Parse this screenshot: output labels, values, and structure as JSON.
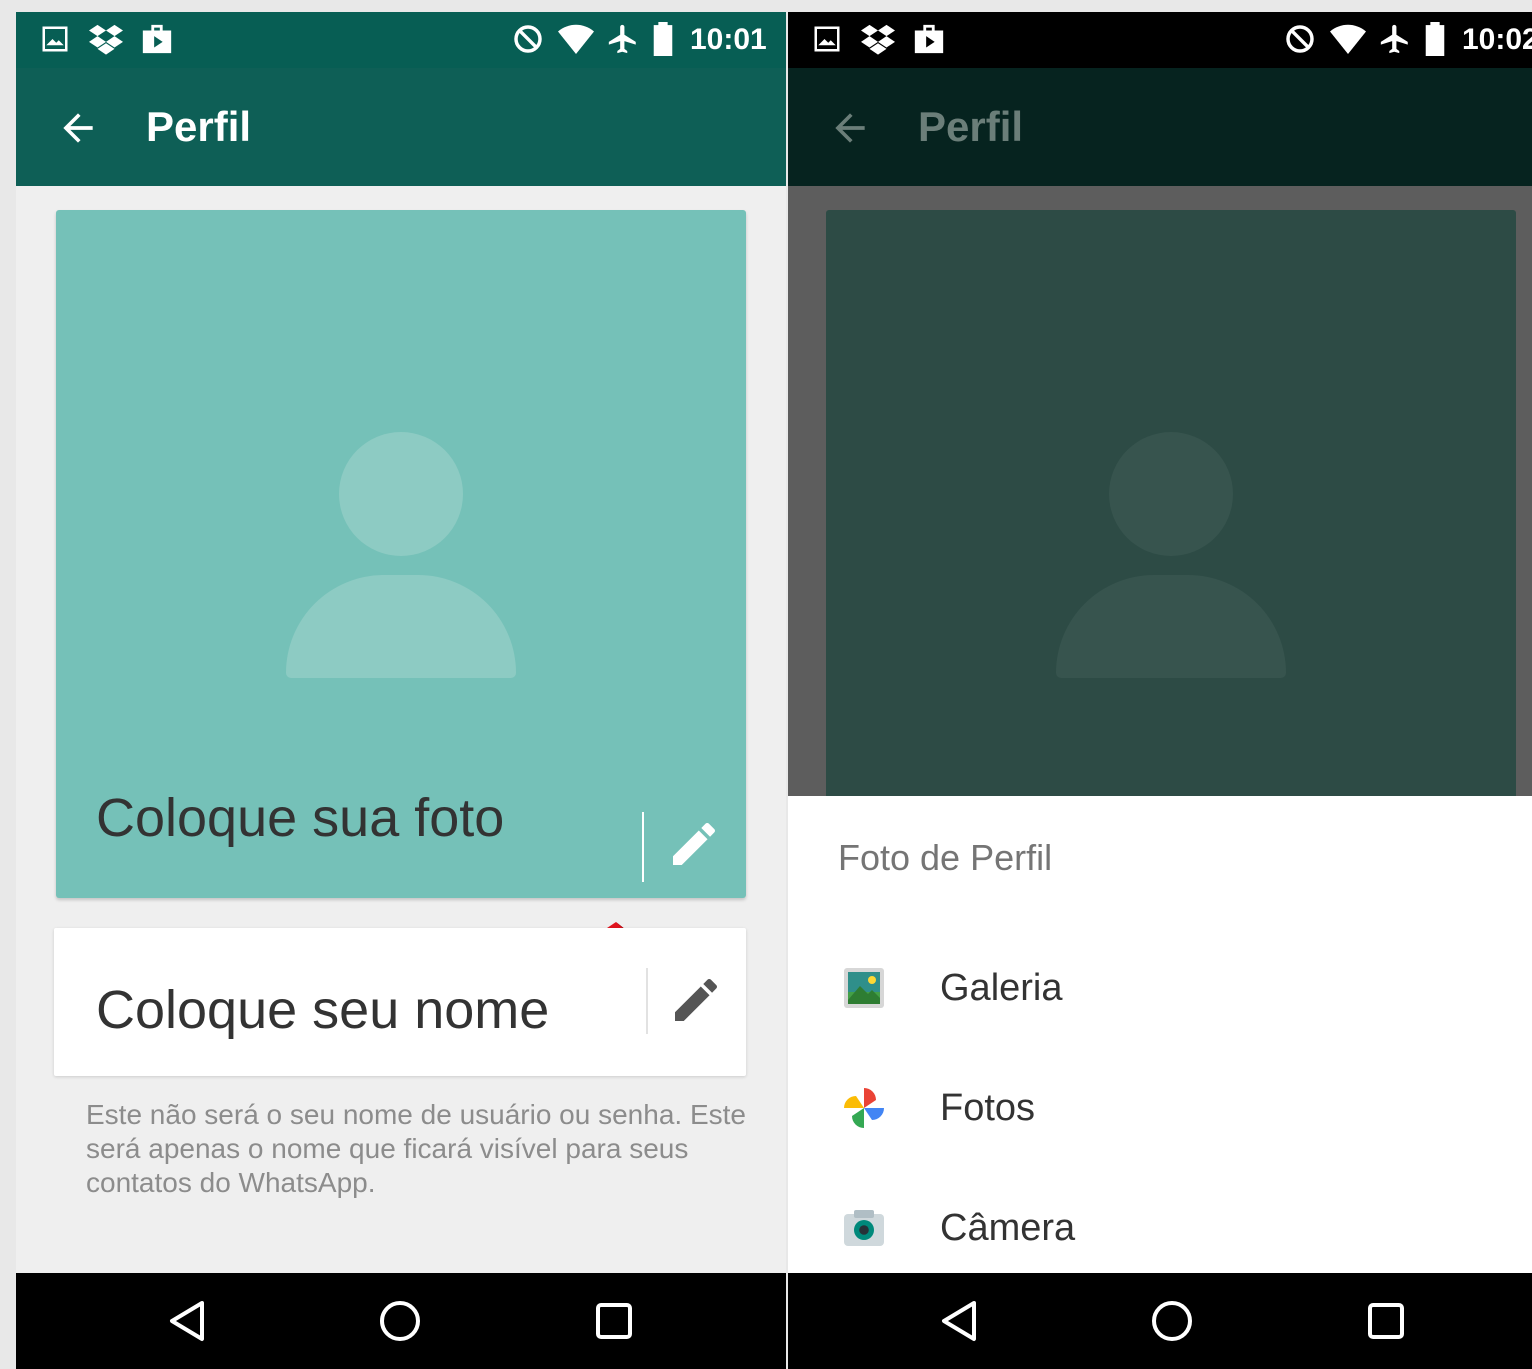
{
  "left_screen": {
    "status_time": "10:01",
    "title": "Perfil",
    "photo_label": "Coloque sua foto",
    "name_label": "Coloque seu nome",
    "hint": "Este não será o seu nome de usuário ou senha. Este será apenas o nome que ficará visível para seus contatos do WhatsApp."
  },
  "right_screen": {
    "status_time": "10:02",
    "title": "Perfil",
    "sheet_title": "Foto de Perfil",
    "options": [
      {
        "label": "Galeria",
        "icon": "gallery-icon"
      },
      {
        "label": "Fotos",
        "icon": "photos-pinwheel-icon"
      },
      {
        "label": "Câmera",
        "icon": "camera-icon"
      }
    ]
  },
  "colors": {
    "accent": "#075e54",
    "photo_placeholder": "#75c1b8",
    "annotation_arrow": "#e0141e"
  }
}
